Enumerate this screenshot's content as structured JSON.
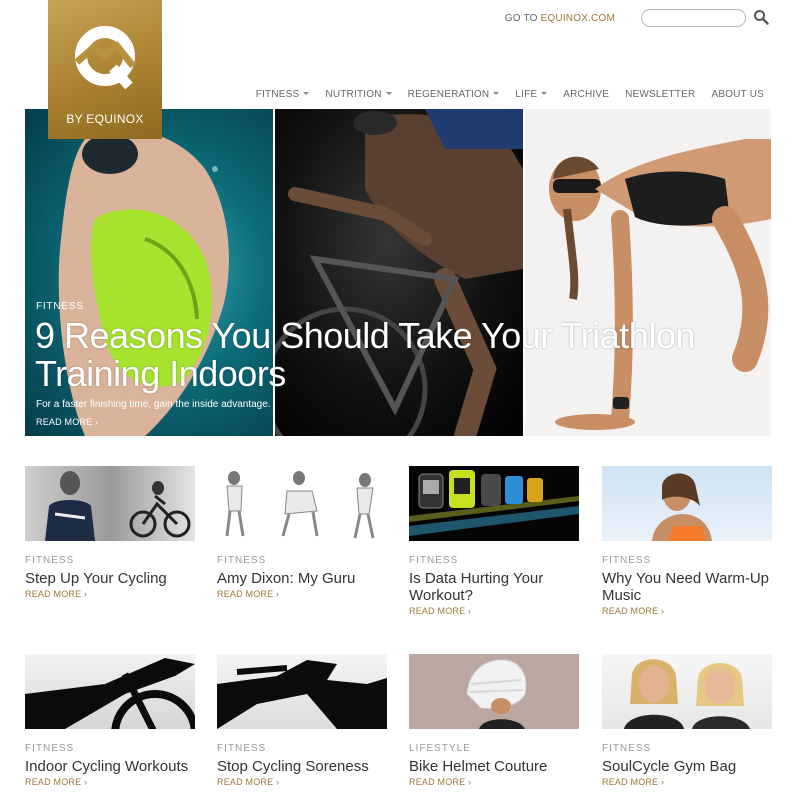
{
  "brand": {
    "by_line": "BY EQUINOX",
    "accent": "#b8913f"
  },
  "header": {
    "goto_prefix": "GO TO ",
    "goto_link": "EQUINOX.COM",
    "search_placeholder": ""
  },
  "nav": [
    {
      "label": "FITNESS",
      "dropdown": true
    },
    {
      "label": "NUTRITION",
      "dropdown": true
    },
    {
      "label": "REGENERATION",
      "dropdown": true
    },
    {
      "label": "LIFE",
      "dropdown": true
    },
    {
      "label": "ARCHIVE",
      "dropdown": false
    },
    {
      "label": "NEWSLETTER",
      "dropdown": false
    },
    {
      "label": "ABOUT US",
      "dropdown": false
    }
  ],
  "hero": {
    "category": "FITNESS",
    "title": "9 Reasons You Should Take Your Triathlon Training Indoors",
    "subtitle": "For a faster finishing time, gain the inside advantage.",
    "read_more": "READ MORE ›"
  },
  "cards": [
    {
      "category": "FITNESS",
      "title": "Step Up Your Cycling",
      "read_more": "READ MORE ›"
    },
    {
      "category": "FITNESS",
      "title": "Amy Dixon: My Guru",
      "read_more": "READ MORE ›"
    },
    {
      "category": "FITNESS",
      "title": "Is Data Hurting Your Workout?",
      "read_more": "READ MORE ›"
    },
    {
      "category": "FITNESS",
      "title": "Why You Need Warm-Up Music",
      "read_more": "READ MORE ›"
    },
    {
      "category": "FITNESS",
      "title": "Indoor Cycling Workouts",
      "read_more": "READ MORE ›"
    },
    {
      "category": "FITNESS",
      "title": "Stop Cycling Soreness",
      "read_more": "READ MORE ›"
    },
    {
      "category": "LIFESTYLE",
      "title": "Bike Helmet Couture",
      "read_more": "READ MORE ›"
    },
    {
      "category": "FITNESS",
      "title": "SoulCycle Gym Bag",
      "read_more": "READ MORE ›"
    }
  ]
}
